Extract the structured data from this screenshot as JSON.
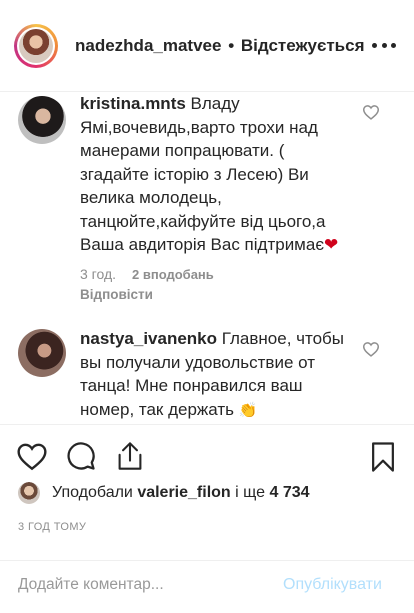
{
  "header": {
    "username": "nadezhda_matvee",
    "separator": "•",
    "follow_status": "Відстежується",
    "more_icon": "more-horizontal-icon"
  },
  "comments": [
    {
      "username": "kristina.mnts",
      "text": "Владу Ямі,вочевидь,варто трохи над манерами попрацювати. ( згадайте історію з Лесею) Ви велика молодець, танцюйте,кайфуйте від цього,а Ваша авдиторія Вас підтримає",
      "emoji": "❤",
      "time": "3 год.",
      "likes": "2 вподобань",
      "reply_label": "Відповісти",
      "like_icon": "heart-outline-icon"
    },
    {
      "username": "nastya_ivanenko",
      "text": "Главное, чтобы вы получали удовольствие от танца! Мне понравился ваш номер, так держать",
      "emoji": "👏",
      "like_icon": "heart-outline-icon"
    }
  ],
  "actions": {
    "like_icon": "heart-outline-icon",
    "comment_icon": "comment-bubble-icon",
    "share_icon": "share-upload-icon",
    "save_icon": "bookmark-icon"
  },
  "likes_summary": {
    "prefix": "Уподобали",
    "user": "valerie_filon",
    "middle": "і ще",
    "count": "4 734"
  },
  "timestamp": "3 ГОД ТОМУ",
  "comment_box": {
    "placeholder": "Додайте коментар...",
    "post_label": "Опублікувати"
  },
  "colors": {
    "text": "#262626",
    "muted": "#8e8e8e",
    "post_disabled": "#b2dffc",
    "heart_red": "#d0021b"
  }
}
